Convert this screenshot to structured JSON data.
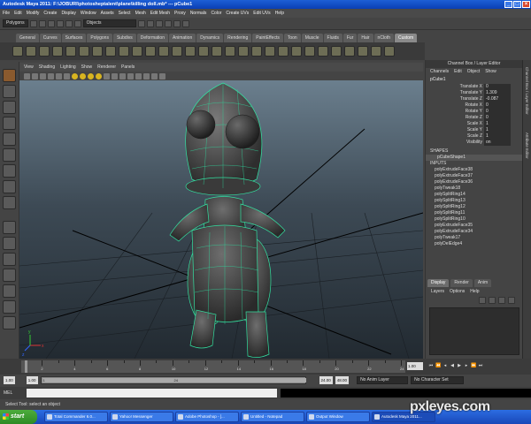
{
  "window": {
    "title": "Autodesk Maya 2011: F:\\JOBURI\\photosheptalent\\plane\\killing doll.mb*   ---   pCube1"
  },
  "menubar": [
    "File",
    "Edit",
    "Modify",
    "Create",
    "Display",
    "Window",
    "Assets",
    "Select",
    "Mesh",
    "Edit Mesh",
    "Proxy",
    "Normals",
    "Color",
    "Create UVs",
    "Edit UVs",
    "Help"
  ],
  "statusline": {
    "mode": "Polygons",
    "objects_field": "Objects"
  },
  "shelf_tabs": [
    "General",
    "Curves",
    "Surfaces",
    "Polygons",
    "Subdivs",
    "Deformation",
    "Animation",
    "Dynamics",
    "Rendering",
    "PaintEffects",
    "Toon",
    "Muscle",
    "Fluids",
    "Fur",
    "Hair",
    "nCloth",
    "Custom"
  ],
  "shelf_active": "Custom",
  "viewport_menu": [
    "View",
    "Shading",
    "Lighting",
    "Show",
    "Renderer",
    "Panels"
  ],
  "channel_box": {
    "header": "Channel Box / Layer Editor",
    "menu": [
      "Channels",
      "Edit",
      "Object",
      "Show"
    ],
    "object": "pCube1",
    "attributes": [
      {
        "name": "Translate X",
        "value": "0"
      },
      {
        "name": "Translate Y",
        "value": "1.309"
      },
      {
        "name": "Translate Z",
        "value": "-0.087"
      },
      {
        "name": "Rotate X",
        "value": "0"
      },
      {
        "name": "Rotate Y",
        "value": "0"
      },
      {
        "name": "Rotate Z",
        "value": "0"
      },
      {
        "name": "Scale X",
        "value": "1"
      },
      {
        "name": "Scale Y",
        "value": "1"
      },
      {
        "name": "Scale Z",
        "value": "1"
      },
      {
        "name": "Visibility",
        "value": "on"
      }
    ],
    "shapes_label": "SHAPES",
    "shape": "pCubeShape1",
    "inputs_label": "INPUTS",
    "inputs": [
      "polyExtrudeFace38",
      "polyExtrudeFace37",
      "polyExtrudeFace36",
      "polyTweak18",
      "polySplitRing14",
      "polySplitRing13",
      "polySplitRing12",
      "polySplitRing11",
      "polySplitRing10",
      "polyExtrudeFace35",
      "polyExtrudeFace34",
      "polyTweak17",
      "polyDelEdge4"
    ]
  },
  "layer_editor": {
    "tabs": [
      "Display",
      "Render",
      "Anim"
    ],
    "menu": [
      "Layers",
      "Options",
      "Help"
    ]
  },
  "side_labels": [
    "Channel Box / Layer Editor",
    "Attribute Editor"
  ],
  "timeline": {
    "ticks": [
      "1",
      "2",
      "4",
      "6",
      "8",
      "10",
      "12",
      "14",
      "16",
      "18",
      "20",
      "22",
      "24"
    ],
    "current_frame": "1.00"
  },
  "range": {
    "start": "1.00",
    "inner_start": "1.00",
    "inner_end_left": "1",
    "inner_end": "24",
    "end_a": "24.00",
    "end_b": "48.00",
    "anim_layer": "No Anim Layer",
    "char_set": "No Character Set"
  },
  "mel": {
    "label": "MEL"
  },
  "help_line": "Select Tool: select an object",
  "taskbar": {
    "start": "start",
    "items": [
      "Total Commander 6.0...",
      "Yahoo! Messenger",
      "Adobe Photoshop - [...",
      "Untitled - Notepad",
      "Output Window",
      "Autodesk Maya 2011..."
    ],
    "active_index": 5
  },
  "watermark": "pxleyes.com",
  "colors": {
    "wire": "#33e0a0",
    "title_bar": "#0a3fb4",
    "taskbar": "#1f57c9",
    "start": "#3b9c2f"
  }
}
